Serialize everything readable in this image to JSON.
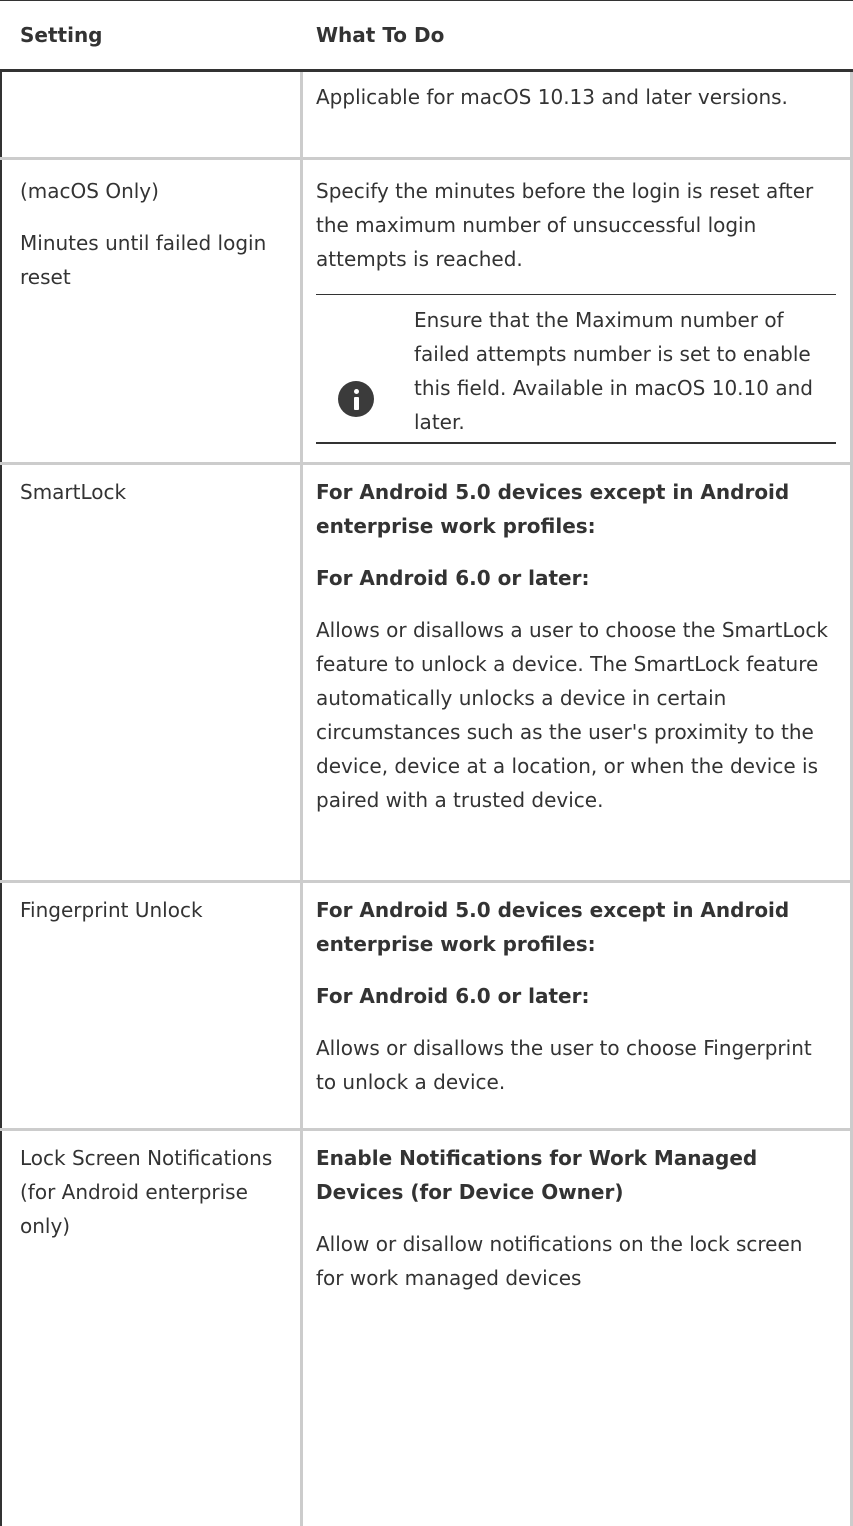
{
  "header": {
    "setting": "Setting",
    "what_to_do": "What To Do"
  },
  "rows": [
    {
      "setting": [],
      "todo": [
        "Applicable for macOS 10.13 and later versions."
      ]
    },
    {
      "setting": [
        "(macOS Only)",
        "Minutes until failed login reset"
      ],
      "todo": [
        "Specify the minutes before the login is reset after the maximum number of unsuccessful login attempts is reached."
      ],
      "note": {
        "icon": "info-icon",
        "text": "Ensure that the Maximum number of failed attempts number is set to enable this field. Available in macOS 10.10 and later."
      }
    },
    {
      "setting": [
        "SmartLock"
      ],
      "todo_bold": [
        "For Android 5.0 devices except in Android enterprise work profiles:",
        "For Android 6.0 or later:"
      ],
      "todo": [
        "Allows or disallows a user to choose the SmartLock feature to unlock a device. The SmartLock feature automatically unlocks a device in certain circumstances such as the user's proximity to the device, device at a location, or when the device is paired with a trusted device."
      ]
    },
    {
      "setting": [
        "Fingerprint Unlock"
      ],
      "todo_bold": [
        "For Android 5.0 devices except in Android enterprise work profiles:",
        "For Android 6.0 or later:"
      ],
      "todo": [
        "Allows or disallows the user to choose Fingerprint to unlock a device."
      ]
    },
    {
      "setting": [
        "Lock Screen Notifications (for Android enterprise only)"
      ],
      "todo_bold": [
        "Enable Notifications for Work Managed Devices (for Device Owner)"
      ],
      "todo": [
        "Allow or disallow notifications on the lock screen for work managed devices"
      ]
    }
  ]
}
